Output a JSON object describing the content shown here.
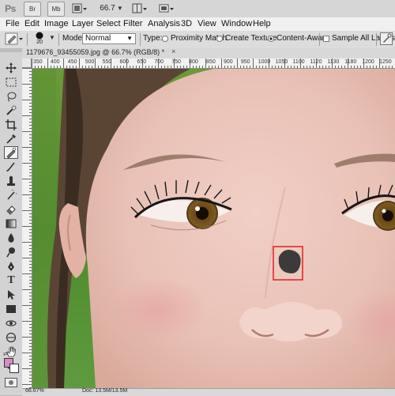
{
  "app_bar": {
    "logo": "Ps",
    "buttons": [
      "Br",
      "Mb"
    ],
    "zoom": "66.7"
  },
  "menu": [
    "File",
    "Edit",
    "Image",
    "Layer",
    "Select",
    "Filter",
    "Analysis",
    "3D",
    "View",
    "Window",
    "Help"
  ],
  "options": {
    "brush_size": "20",
    "mode_label": "Mode:",
    "mode_value": "Normal",
    "type_label": "Type:",
    "type_options": [
      "Proximity Match",
      "Create Texture",
      "Content-Aware"
    ],
    "type_selected": "Content-Aware",
    "sample_all_layers": "Sample All Layers"
  },
  "document": {
    "tab_title": "1179676_93455059.jpg @ 66.7% (RGB/8) *",
    "ruler_top": [
      "350",
      "400",
      "450",
      "500",
      "550",
      "600",
      "650",
      "700",
      "750",
      "800",
      "850",
      "900",
      "950",
      "1000",
      "1050",
      "1100",
      "1120",
      "1130",
      "1180",
      "1200",
      "1250"
    ],
    "status_zoom": "66.67%",
    "status_doc": "Doc: 13.5M/13.5M"
  },
  "colors": {
    "foreground": "#d88ac9",
    "background": "#ffffff",
    "selection_box": "#e02020"
  },
  "icons": [
    "move-icon",
    "marquee-icon",
    "lasso-icon",
    "quick-select-icon",
    "crop-icon",
    "eyedropper-icon",
    "spot-healing-brush-icon",
    "brush-icon",
    "clone-stamp-icon",
    "history-brush-icon",
    "eraser-icon",
    "gradient-icon",
    "blur-icon",
    "dodge-icon",
    "pen-icon",
    "type-icon",
    "path-select-icon",
    "shape-icon",
    "3d-rotate-icon",
    "3d-orbit-icon",
    "hand-icon",
    "zoom-icon"
  ]
}
